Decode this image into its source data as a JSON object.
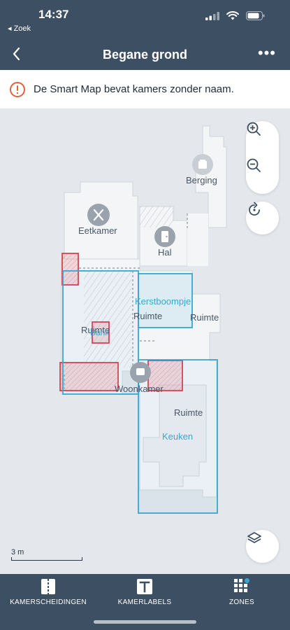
{
  "status_bar": {
    "time": "14:37",
    "back_app": "◂ Zoek"
  },
  "nav": {
    "title": "Begane grond",
    "more": "•••"
  },
  "banner": {
    "message": "De Smart Map bevat kamers zonder naam."
  },
  "rooms": [
    {
      "name": "Berging",
      "icon": "box-icon"
    },
    {
      "name": "Eetkamer",
      "icon": "cutlery-icon"
    },
    {
      "name": "Hal",
      "icon": "door-icon"
    },
    {
      "name": "Ruimte"
    },
    {
      "name": "Ruimte"
    },
    {
      "name": "Ruimte"
    },
    {
      "name": "Woonkamer",
      "icon": "sofa-icon"
    },
    {
      "name": "Ruimte"
    }
  ],
  "zones": [
    {
      "name": "Kerstboompje"
    },
    {
      "name": "Bank"
    },
    {
      "name": "Keuken"
    }
  ],
  "map_controls": {
    "zoom_in": "zoom-in-icon",
    "zoom_out": "zoom-out-icon",
    "reset": "reset-rotate-icon",
    "layers": "layers-icon"
  },
  "scale": {
    "label": "3 m"
  },
  "bottom_tabs": [
    {
      "label": "KAMERSCHEIDINGEN",
      "icon": "divider-icon"
    },
    {
      "label": "KAMERLABELS",
      "icon": "text-label-icon"
    },
    {
      "label": "ZONES",
      "icon": "zones-icon"
    }
  ],
  "colors": {
    "header_bg": "#3d4f62",
    "zone_blue": "#3aa6d0",
    "no_go_red": "#d9414f",
    "warning_orange": "#e2603f",
    "room_fill": "#f4f5f7"
  }
}
